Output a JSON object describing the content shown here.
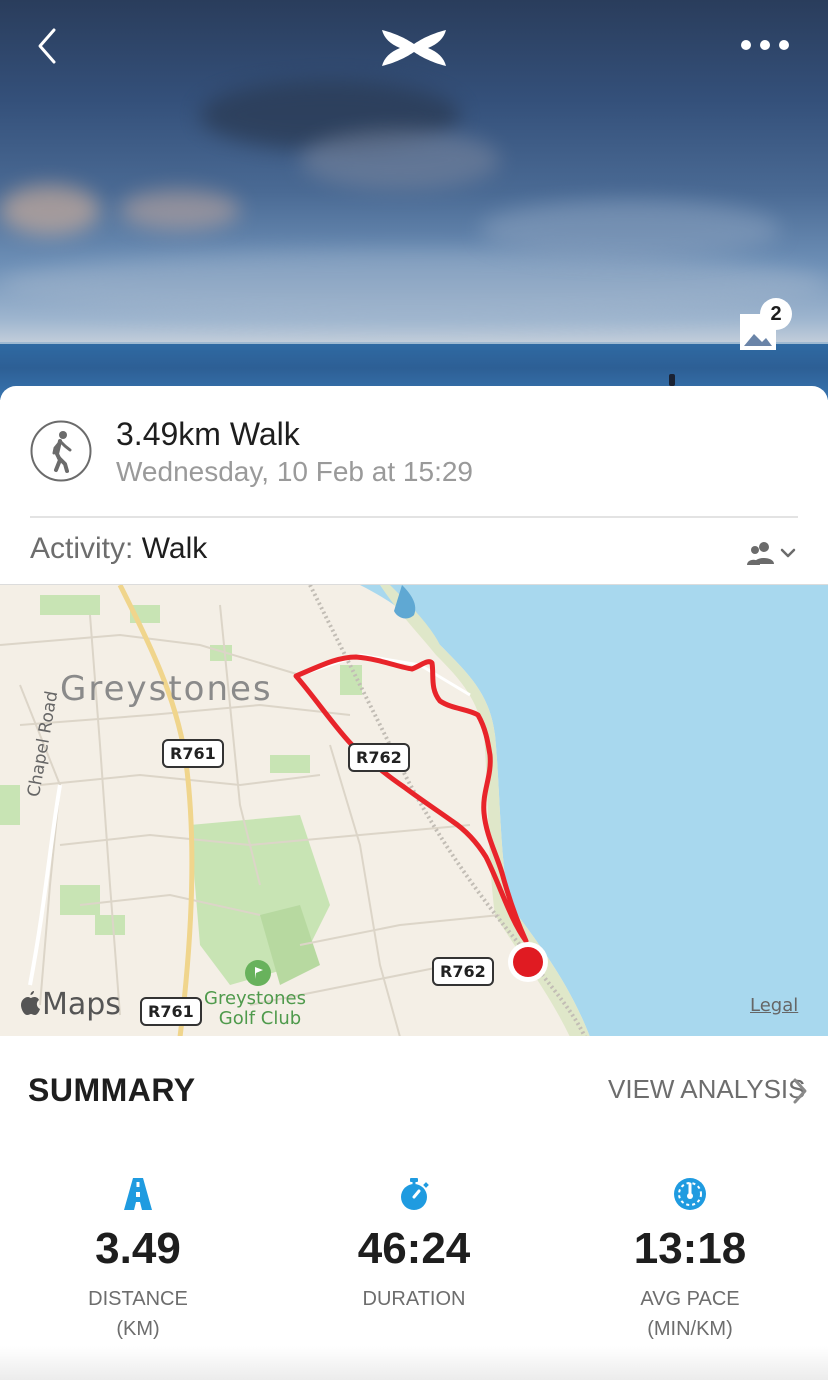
{
  "header": {
    "back_icon": "chevron-left-icon",
    "logo": "under-armour-logo",
    "more_icon": "more-horizontal-icon",
    "photos_icon": "image-icon",
    "photos_count": "2"
  },
  "workout": {
    "title": "3.49km Walk",
    "datetime": "Wednesday, 10 Feb at 15:29",
    "activity_label": "Activity:",
    "activity_value": "Walk",
    "privacy_icon": "friends-icon"
  },
  "map": {
    "place": "Greystones",
    "roads": [
      "R761",
      "R762",
      "R762",
      "R761"
    ],
    "street": "Chapel Road",
    "golf_line1": "Greystones",
    "golf_line2": "Golf Club",
    "brand": "Maps",
    "legal": "Legal",
    "route_color": "#e8242a",
    "sea_color": "#a8d8ee",
    "land_color": "#f4efe6",
    "park_color": "#c8e4b4"
  },
  "summary": {
    "title": "SUMMARY",
    "view_analysis": "VIEW ANALYSIS",
    "accent_color": "#1f9be0",
    "stats": [
      {
        "icon": "distance-icon",
        "value": "3.49",
        "label": "DISTANCE",
        "unit": "(KM)"
      },
      {
        "icon": "stopwatch-icon",
        "value": "46:24",
        "label": "DURATION",
        "unit": ""
      },
      {
        "icon": "speedometer-icon",
        "value": "13:18",
        "label": "AVG PACE",
        "unit": "(MIN/KM)"
      }
    ]
  }
}
